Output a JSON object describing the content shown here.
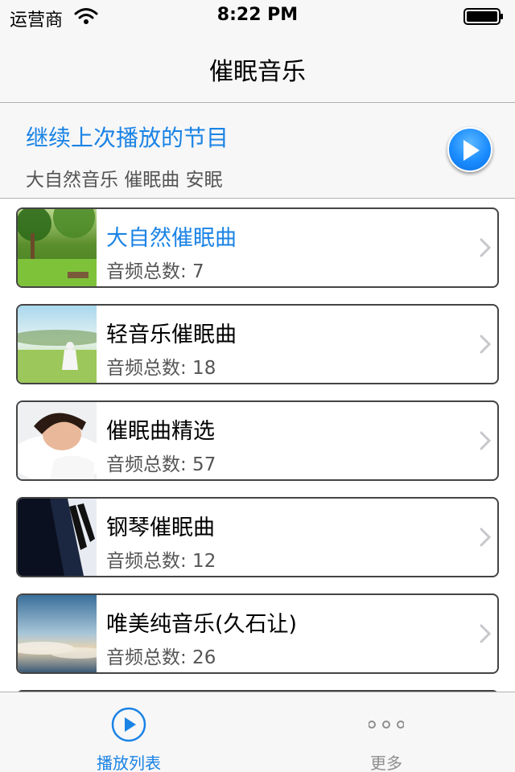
{
  "status_bar": {
    "carrier": "运营商",
    "time": "8:22 PM"
  },
  "nav": {
    "title": "催眠音乐"
  },
  "resume": {
    "title": "继续上次播放的节目",
    "subtitle": "大自然音乐 催眠曲 安眠",
    "play_icon": "play-icon"
  },
  "playlists": [
    {
      "title": "大自然催眠曲",
      "count": "音频总数: 7",
      "highlighted": true
    },
    {
      "title": "轻音乐催眠曲",
      "count": "音频总数: 18"
    },
    {
      "title": "催眠曲精选",
      "count": "音频总数: 57"
    },
    {
      "title": "钢琴催眠曲",
      "count": "音频总数: 12"
    },
    {
      "title": "唯美纯音乐(久石让)",
      "count": "音频总数: 26"
    }
  ],
  "tabs": [
    {
      "label": "播放列表",
      "icon": "play-circle-icon",
      "active": true
    },
    {
      "label": "更多",
      "icon": "more-dots-icon",
      "active": false
    }
  ],
  "colors": {
    "accent": "#1a83e6",
    "bar_bg": "#f7f7f7",
    "border": "#444444",
    "muted": "#8e8e8e"
  }
}
